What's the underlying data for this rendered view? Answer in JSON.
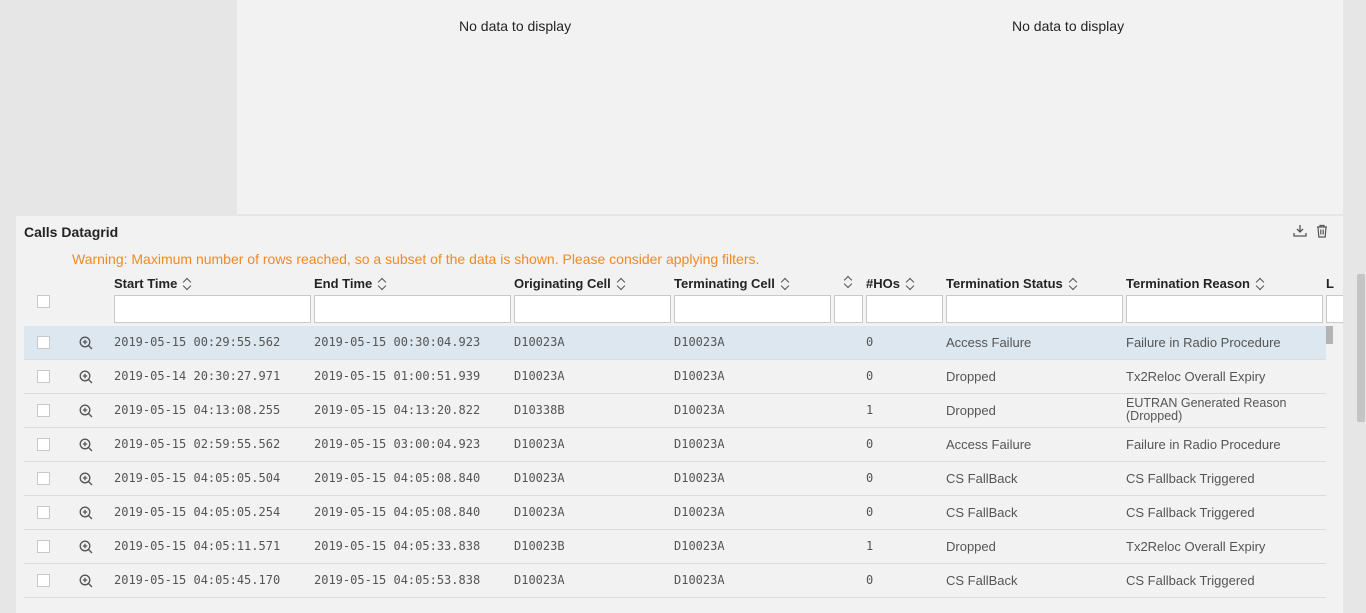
{
  "top_panels": {
    "left_message": "No data to display",
    "right_message": "No data to display"
  },
  "datagrid": {
    "title": "Calls Datagrid",
    "warning": "Warning: Maximum number of rows reached, so a subset of the data is shown. Please consider applying filters.",
    "icons": {
      "download": "download-icon",
      "delete": "trash-icon",
      "zoom": "zoom-in-icon",
      "sort": "sort-icon"
    },
    "columns": [
      "Start Time",
      "End Time",
      "Originating Cell",
      "Terminating Cell",
      "",
      "#HOs",
      "Termination Status",
      "Termination Reason",
      "L"
    ],
    "rows": [
      {
        "start": "2019-05-15 00:29:55.562",
        "end": "2019-05-15 00:30:04.923",
        "orig": "D10023A",
        "term": "D10023A",
        "hos": "0",
        "status": "Access Failure",
        "reason": "Failure in Radio Procedure",
        "selected": true
      },
      {
        "start": "2019-05-14 20:30:27.971",
        "end": "2019-05-15 01:00:51.939",
        "orig": "D10023A",
        "term": "D10023A",
        "hos": "0",
        "status": "Dropped",
        "reason": "Tx2Reloc Overall Expiry"
      },
      {
        "start": "2019-05-15 04:13:08.255",
        "end": "2019-05-15 04:13:20.822",
        "orig": "D10338B",
        "term": "D10023A",
        "hos": "1",
        "status": "Dropped",
        "reason": "EUTRAN Generated Reason (Dropped)"
      },
      {
        "start": "2019-05-15 02:59:55.562",
        "end": "2019-05-15 03:00:04.923",
        "orig": "D10023A",
        "term": "D10023A",
        "hos": "0",
        "status": "Access Failure",
        "reason": "Failure in Radio Procedure"
      },
      {
        "start": "2019-05-15 04:05:05.504",
        "end": "2019-05-15 04:05:08.840",
        "orig": "D10023A",
        "term": "D10023A",
        "hos": "0",
        "status": "CS FallBack",
        "reason": "CS Fallback Triggered"
      },
      {
        "start": "2019-05-15 04:05:05.254",
        "end": "2019-05-15 04:05:08.840",
        "orig": "D10023A",
        "term": "D10023A",
        "hos": "0",
        "status": "CS FallBack",
        "reason": "CS Fallback Triggered"
      },
      {
        "start": "2019-05-15 04:05:11.571",
        "end": "2019-05-15 04:05:33.838",
        "orig": "D10023B",
        "term": "D10023A",
        "hos": "1",
        "status": "Dropped",
        "reason": "Tx2Reloc Overall Expiry"
      },
      {
        "start": "2019-05-15 04:05:45.170",
        "end": "2019-05-15 04:05:53.838",
        "orig": "D10023A",
        "term": "D10023A",
        "hos": "0",
        "status": "CS FallBack",
        "reason": "CS Fallback Triggered"
      }
    ]
  }
}
